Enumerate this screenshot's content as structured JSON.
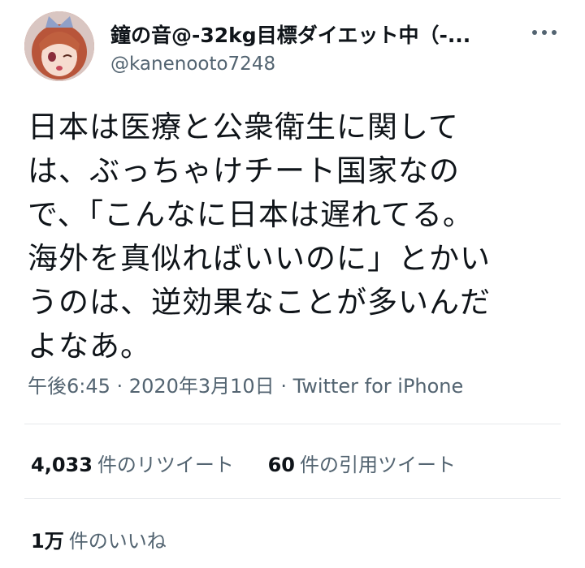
{
  "user": {
    "display_name": "鐘の音@-32kg目標ダイエット中（-...",
    "handle": "@kanenooto7248"
  },
  "tweet": {
    "text": "日本は医療と公衆衛生に関して\nは、ぶっちゃけチート国家なの\nで、「こんなに日本は遅れてる。\n海外を真似ればいいのに」とかい\nうのは、逆効果なことが多いんだ\nよなあ。",
    "time": "午後6:45",
    "date": "2020年3月10日",
    "source": "Twitter for iPhone",
    "separator": " · "
  },
  "stats": {
    "retweets_count": "4,033",
    "retweets_label": "件のリツイート",
    "quotes_count": "60",
    "quotes_label": "件の引用ツイート",
    "likes_count": "1万",
    "likes_label": "件のいいね"
  },
  "icons": {
    "more": "more-horizontal-icon",
    "avatar": "anime-character-avatar"
  },
  "colors": {
    "text": "#0f1419",
    "secondary": "#536471",
    "divider": "#e6e9ec"
  }
}
